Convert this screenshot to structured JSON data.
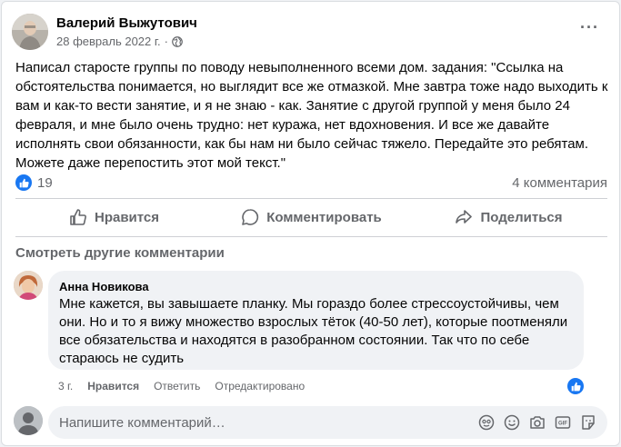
{
  "post": {
    "author": "Валерий Выжутович",
    "date": "28 февраль 2022 г.",
    "dot": "·",
    "more": "···",
    "text": "Написал старосте группы по поводу невыполненного всеми дом. задания: \"Ссылка на обстоятельства понимается, но выглядит все же отмазкой. Мне завтра тоже надо выходить к вам и как-то вести занятие, и я не знаю  - как. Занятие с другой группой у меня было 24 февраля, и мне было очень трудно: нет куража, нет вдохновения. И все же давайте исполнять свои обязанности, как бы нам ни было сейчас тяжело. Передайте это ребятам. Можете даже перепостить этот мой текст.\"",
    "likes_count": "19",
    "comments_count": "4 комментария"
  },
  "actions": {
    "like": "Нравится",
    "comment": "Комментировать",
    "share": "Поделиться"
  },
  "comments_section": {
    "more_comments": "Смотреть другие комментарии",
    "comment": {
      "author": "Анна Новикова",
      "text": "Мне кажется, вы завышаете планку. Мы гораздо более стрессоустойчивы, чем они. Но и то я вижу множество взрослых тёток (40-50 лет), которые поотменяли все обязательства и находятся в разобранном состоянии. Так что по себе стараюсь не судить",
      "age": "3 г.",
      "like": "Нравится",
      "reply": "Ответить",
      "edited": "Отредактировано"
    },
    "compose_placeholder": "Напишите комментарий…"
  },
  "icons": {
    "globe": "globe-icon",
    "like": "thumbs-up-icon",
    "comment": "speech-bubble-icon",
    "share": "share-arrow-icon",
    "emoji": "smiley-icon",
    "camera": "camera-icon",
    "gif": "gif-icon",
    "sticker": "sticker-icon",
    "avatar_mask": "avatar-emoji-icon"
  },
  "colors": {
    "accent": "#1877f2",
    "secondary_text": "#65676b",
    "bubble_bg": "#f0f2f5"
  }
}
